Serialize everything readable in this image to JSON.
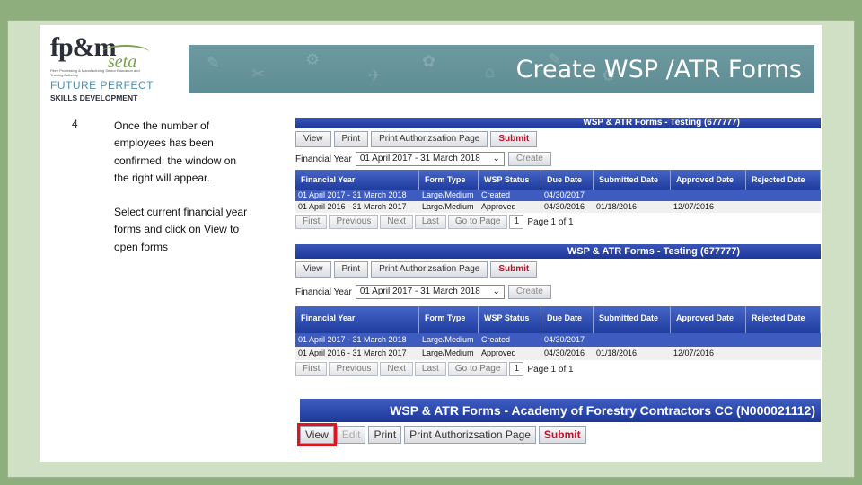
{
  "logo": {
    "fp": "fp&m",
    "seta": "seta",
    "tagline": "Fibre Processing & Manufacturing Sector Education and Training Authority",
    "future": "FUTURE PERFECT",
    "skills": "SKILLS DEVELOPMENT"
  },
  "banner": {
    "title": "Create WSP /ATR Forms"
  },
  "step": {
    "number": "4",
    "text1": "Once the number of employees has been confirmed, the window on the right will appear.",
    "text2": "Select current financial year forms and click on View  to open forms"
  },
  "shot1": {
    "title": "WSP & ATR Forms - Testing (677777)",
    "buttons": [
      "View",
      "Print",
      "Print Authorizsation Page",
      "Submit"
    ],
    "fy_label": "Financial Year",
    "fy_value": "01 April 2017 - 31 March 2018",
    "create": "Create",
    "headers": [
      "Financial Year",
      "Form Type",
      "WSP Status",
      "Due Date",
      "Submitted Date",
      "Approved Date",
      "Rejected Date"
    ],
    "rows": [
      [
        "01 April 2017 - 31 March 2018",
        "Large/Medium",
        "Created",
        "04/30/2017",
        "",
        "",
        ""
      ],
      [
        "01 April 2016 - 31 March 2017",
        "Large/Medium",
        "Approved",
        "04/30/2016",
        "01/18/2016",
        "12/07/2016",
        ""
      ]
    ],
    "pager": [
      "First",
      "Previous",
      "Next",
      "Last",
      "Go to Page"
    ],
    "page_num": "1",
    "page_info": "Page 1 of 1"
  },
  "shot2": {
    "title": "WSP & ATR Forms - Testing (677777)",
    "buttons": [
      "View",
      "Print",
      "Print Authorizsation Page",
      "Submit"
    ],
    "fy_label": "Financial Year",
    "fy_value": "01 April 2017 - 31 March 2018",
    "create": "Create",
    "headers": [
      "Financial Year",
      "Form Type",
      "WSP Status",
      "Due Date",
      "Submitted Date",
      "Approved Date",
      "Rejected Date"
    ],
    "rows": [
      [
        "01 April 2017 - 31 March 2018",
        "Large/Medium",
        "Created",
        "04/30/2017",
        "",
        "",
        ""
      ],
      [
        "01 April 2016 - 31 March 2017",
        "Large/Medium",
        "Approved",
        "04/30/2016",
        "01/18/2016",
        "12/07/2016",
        ""
      ]
    ],
    "pager": [
      "First",
      "Previous",
      "Next",
      "Last",
      "Go to Page"
    ],
    "page_num": "1",
    "page_info": "Page 1 of 1"
  },
  "shot3": {
    "title": "WSP & ATR Forms - Academy of Forestry Contractors CC (N000021112)",
    "buttons": [
      "View",
      "Edit",
      "Print",
      "Print Authorizsation Page",
      "Submit"
    ]
  },
  "colors": {
    "banner": "#6d9aa0",
    "table_header": "#1f3c9e",
    "submit": "#c0102a",
    "highlight": "#e0141e"
  }
}
